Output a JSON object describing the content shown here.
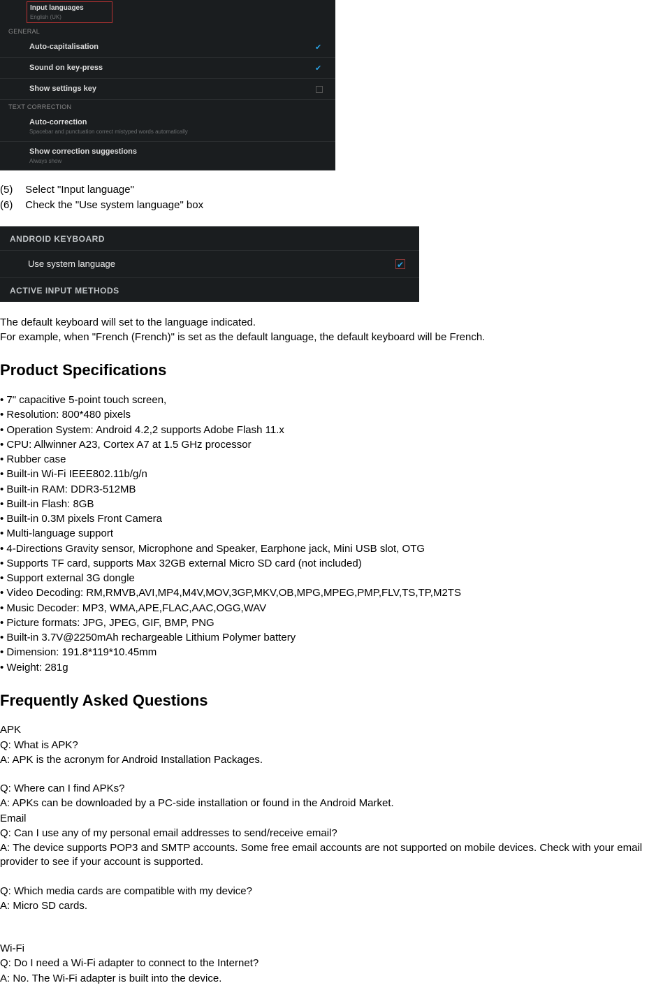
{
  "screenshot1": {
    "input_lang_title": "Input languages",
    "input_lang_sub": "English (UK)",
    "group_general": "GENERAL",
    "auto_cap": "Auto-capitalisation",
    "sound_key": "Sound on key-press",
    "show_settings": "Show settings key",
    "group_text_corr": "TEXT CORRECTION",
    "auto_corr_title": "Auto-correction",
    "auto_corr_sub": "Spacebar and punctuation correct mistyped words automatically",
    "show_corr_title": "Show correction suggestions",
    "show_corr_sub": "Always show"
  },
  "steps": {
    "s5_num": "(5)",
    "s5_text": "Select \"Input language\"",
    "s6_num": "(6)",
    "s6_text": "Check the \"Use system language\" box"
  },
  "screenshot2": {
    "hdr1": "ANDROID KEYBOARD",
    "row": "Use system language",
    "hdr2": "ACTIVE INPUT METHODS"
  },
  "para1": "The default keyboard will set to the language indicated.",
  "para2": "For example, when \"French (French)\" is set as the default language, the default keyboard will be French.",
  "specs_heading": "Product Specifications",
  "specs": [
    "• 7\" capacitive 5-point touch screen,",
    "• Resolution: 800*480 pixels",
    "• Operation System: Android 4.2,2 supports Adobe Flash 11.x",
    "• CPU: Allwinner A23, Cortex A7 at 1.5 GHz processor",
    "• Rubber case",
    "• Built-in Wi-Fi IEEE802.11b/g/n",
    "• Built-in RAM: DDR3-512MB",
    "• Built-in Flash: 8GB",
    "• Built-in 0.3M pixels Front Camera",
    "• Multi-language support",
    "• 4-Directions Gravity sensor, Microphone and Speaker, Earphone jack, Mini USB slot, OTG",
    "• Supports TF card, supports Max 32GB external Micro SD card (not included)",
    "• Support external 3G dongle",
    "• Video Decoding: RM,RMVB,AVI,MP4,M4V,MOV,3GP,MKV,OB,MPG,MPEG,PMP,FLV,TS,TP,M2TS",
    "• Music Decoder: MP3, WMA,APE,FLAC,AAC,OGG,WAV",
    "• Picture formats: JPG, JPEG, GIF, BMP, PNG",
    "• Built-in 3.7V@2250mAh rechargeable Lithium Polymer battery",
    "• Dimension: 191.8*119*10.45mm",
    "• Weight: 281g"
  ],
  "faq_heading": "Frequently Asked Questions",
  "faq": {
    "apk_hdr": "APK",
    "q1": "Q: What is APK?",
    "a1": "A: APK is the acronym for Android Installation Packages.",
    "q2": "Q: Where can I find APKs?",
    "a2": "A: APKs can be downloaded by a PC-side installation or found in the Android Market.",
    "email_hdr": "Email",
    "q3": "Q: Can I use any of my personal email addresses to send/receive email?",
    "a3": "A: The device supports POP3 and SMTP accounts. Some free email accounts are not supported on mobile devices. Check with your email provider to see if your account is supported.",
    "q4": "Q: Which media cards are compatible with my device?",
    "a4": "A: Micro SD cards.",
    "wifi_hdr": "Wi-Fi",
    "q5": "Q: Do I need a Wi-Fi adapter to connect to the Internet?",
    "a5": "A: No. The Wi-Fi adapter is built into the device."
  }
}
